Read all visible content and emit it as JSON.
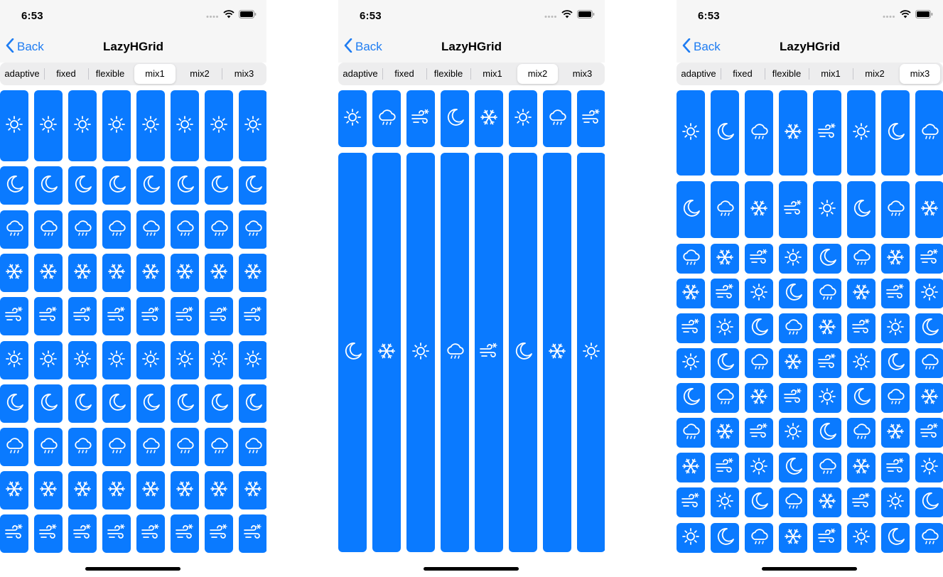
{
  "screens": [
    {
      "time": "6:53",
      "back_label": "Back",
      "title": "LazyHGrid",
      "selected_tab": 3
    },
    {
      "time": "6:53",
      "back_label": "Back",
      "title": "LazyHGrid",
      "selected_tab": 4
    },
    {
      "time": "6:53",
      "back_label": "Back",
      "title": "LazyHGrid",
      "selected_tab": 5
    }
  ],
  "tabs": [
    "adaptive",
    "fixed",
    "flexible",
    "mix1",
    "mix2",
    "mix3"
  ],
  "colors": {
    "accent": "#1e7cf2",
    "tile": "#0a7aff",
    "segment_bg": "#ededee",
    "bar_bg": "#f6f6f6"
  },
  "icons": [
    "sun-icon",
    "moon-icon",
    "cloud-rain-icon",
    "snowflake-icon",
    "wind-snow-icon"
  ],
  "grids": [
    {
      "columns": 8,
      "rows": [
        [
          "sun-icon",
          "sun-icon",
          "sun-icon",
          "sun-icon",
          "sun-icon",
          "sun-icon",
          "sun-icon",
          "sun-icon"
        ],
        [
          "moon-icon",
          "moon-icon",
          "moon-icon",
          "moon-icon",
          "moon-icon",
          "moon-icon",
          "moon-icon",
          "moon-icon"
        ],
        [
          "cloud-rain-icon",
          "cloud-rain-icon",
          "cloud-rain-icon",
          "cloud-rain-icon",
          "cloud-rain-icon",
          "cloud-rain-icon",
          "cloud-rain-icon",
          "cloud-rain-icon"
        ],
        [
          "snowflake-icon",
          "snowflake-icon",
          "snowflake-icon",
          "snowflake-icon",
          "snowflake-icon",
          "snowflake-icon",
          "snowflake-icon",
          "snowflake-icon"
        ],
        [
          "wind-snow-icon",
          "wind-snow-icon",
          "wind-snow-icon",
          "wind-snow-icon",
          "wind-snow-icon",
          "wind-snow-icon",
          "wind-snow-icon",
          "wind-snow-icon"
        ],
        [
          "sun-icon",
          "sun-icon",
          "sun-icon",
          "sun-icon",
          "sun-icon",
          "sun-icon",
          "sun-icon",
          "sun-icon"
        ],
        [
          "moon-icon",
          "moon-icon",
          "moon-icon",
          "moon-icon",
          "moon-icon",
          "moon-icon",
          "moon-icon",
          "moon-icon"
        ],
        [
          "cloud-rain-icon",
          "cloud-rain-icon",
          "cloud-rain-icon",
          "cloud-rain-icon",
          "cloud-rain-icon",
          "cloud-rain-icon",
          "cloud-rain-icon",
          "cloud-rain-icon"
        ],
        [
          "snowflake-icon",
          "snowflake-icon",
          "snowflake-icon",
          "snowflake-icon",
          "snowflake-icon",
          "snowflake-icon",
          "snowflake-icon",
          "snowflake-icon"
        ],
        [
          "wind-snow-icon",
          "wind-snow-icon",
          "wind-snow-icon",
          "wind-snow-icon",
          "wind-snow-icon",
          "wind-snow-icon",
          "wind-snow-icon",
          "wind-snow-icon"
        ]
      ]
    },
    {
      "columns": 8,
      "rows": [
        [
          "sun-icon",
          "cloud-rain-icon",
          "wind-snow-icon",
          "moon-icon",
          "snowflake-icon",
          "sun-icon",
          "cloud-rain-icon",
          "wind-snow-icon"
        ],
        [
          "moon-icon",
          "snowflake-icon",
          "sun-icon",
          "cloud-rain-icon",
          "wind-snow-icon",
          "moon-icon",
          "snowflake-icon",
          "sun-icon"
        ]
      ]
    },
    {
      "columns": 8,
      "rows": [
        [
          "sun-icon",
          "moon-icon",
          "cloud-rain-icon",
          "snowflake-icon",
          "wind-snow-icon",
          "sun-icon",
          "moon-icon",
          "cloud-rain-icon"
        ],
        [
          "moon-icon",
          "cloud-rain-icon",
          "snowflake-icon",
          "wind-snow-icon",
          "sun-icon",
          "moon-icon",
          "cloud-rain-icon",
          "snowflake-icon"
        ],
        [
          "cloud-rain-icon",
          "snowflake-icon",
          "wind-snow-icon",
          "sun-icon",
          "moon-icon",
          "cloud-rain-icon",
          "snowflake-icon",
          "wind-snow-icon"
        ],
        [
          "snowflake-icon",
          "wind-snow-icon",
          "sun-icon",
          "moon-icon",
          "cloud-rain-icon",
          "snowflake-icon",
          "wind-snow-icon",
          "sun-icon"
        ],
        [
          "wind-snow-icon",
          "sun-icon",
          "moon-icon",
          "cloud-rain-icon",
          "snowflake-icon",
          "wind-snow-icon",
          "sun-icon",
          "moon-icon"
        ],
        [
          "sun-icon",
          "moon-icon",
          "cloud-rain-icon",
          "snowflake-icon",
          "wind-snow-icon",
          "sun-icon",
          "moon-icon",
          "cloud-rain-icon"
        ],
        [
          "moon-icon",
          "cloud-rain-icon",
          "snowflake-icon",
          "wind-snow-icon",
          "sun-icon",
          "moon-icon",
          "cloud-rain-icon",
          "snowflake-icon"
        ],
        [
          "cloud-rain-icon",
          "snowflake-icon",
          "wind-snow-icon",
          "sun-icon",
          "moon-icon",
          "cloud-rain-icon",
          "snowflake-icon",
          "wind-snow-icon"
        ],
        [
          "snowflake-icon",
          "wind-snow-icon",
          "sun-icon",
          "moon-icon",
          "cloud-rain-icon",
          "snowflake-icon",
          "wind-snow-icon",
          "sun-icon"
        ],
        [
          "wind-snow-icon",
          "sun-icon",
          "moon-icon",
          "cloud-rain-icon",
          "snowflake-icon",
          "wind-snow-icon",
          "sun-icon",
          "moon-icon"
        ],
        [
          "sun-icon",
          "moon-icon",
          "cloud-rain-icon",
          "snowflake-icon",
          "wind-snow-icon",
          "sun-icon",
          "moon-icon",
          "cloud-rain-icon"
        ]
      ]
    }
  ]
}
